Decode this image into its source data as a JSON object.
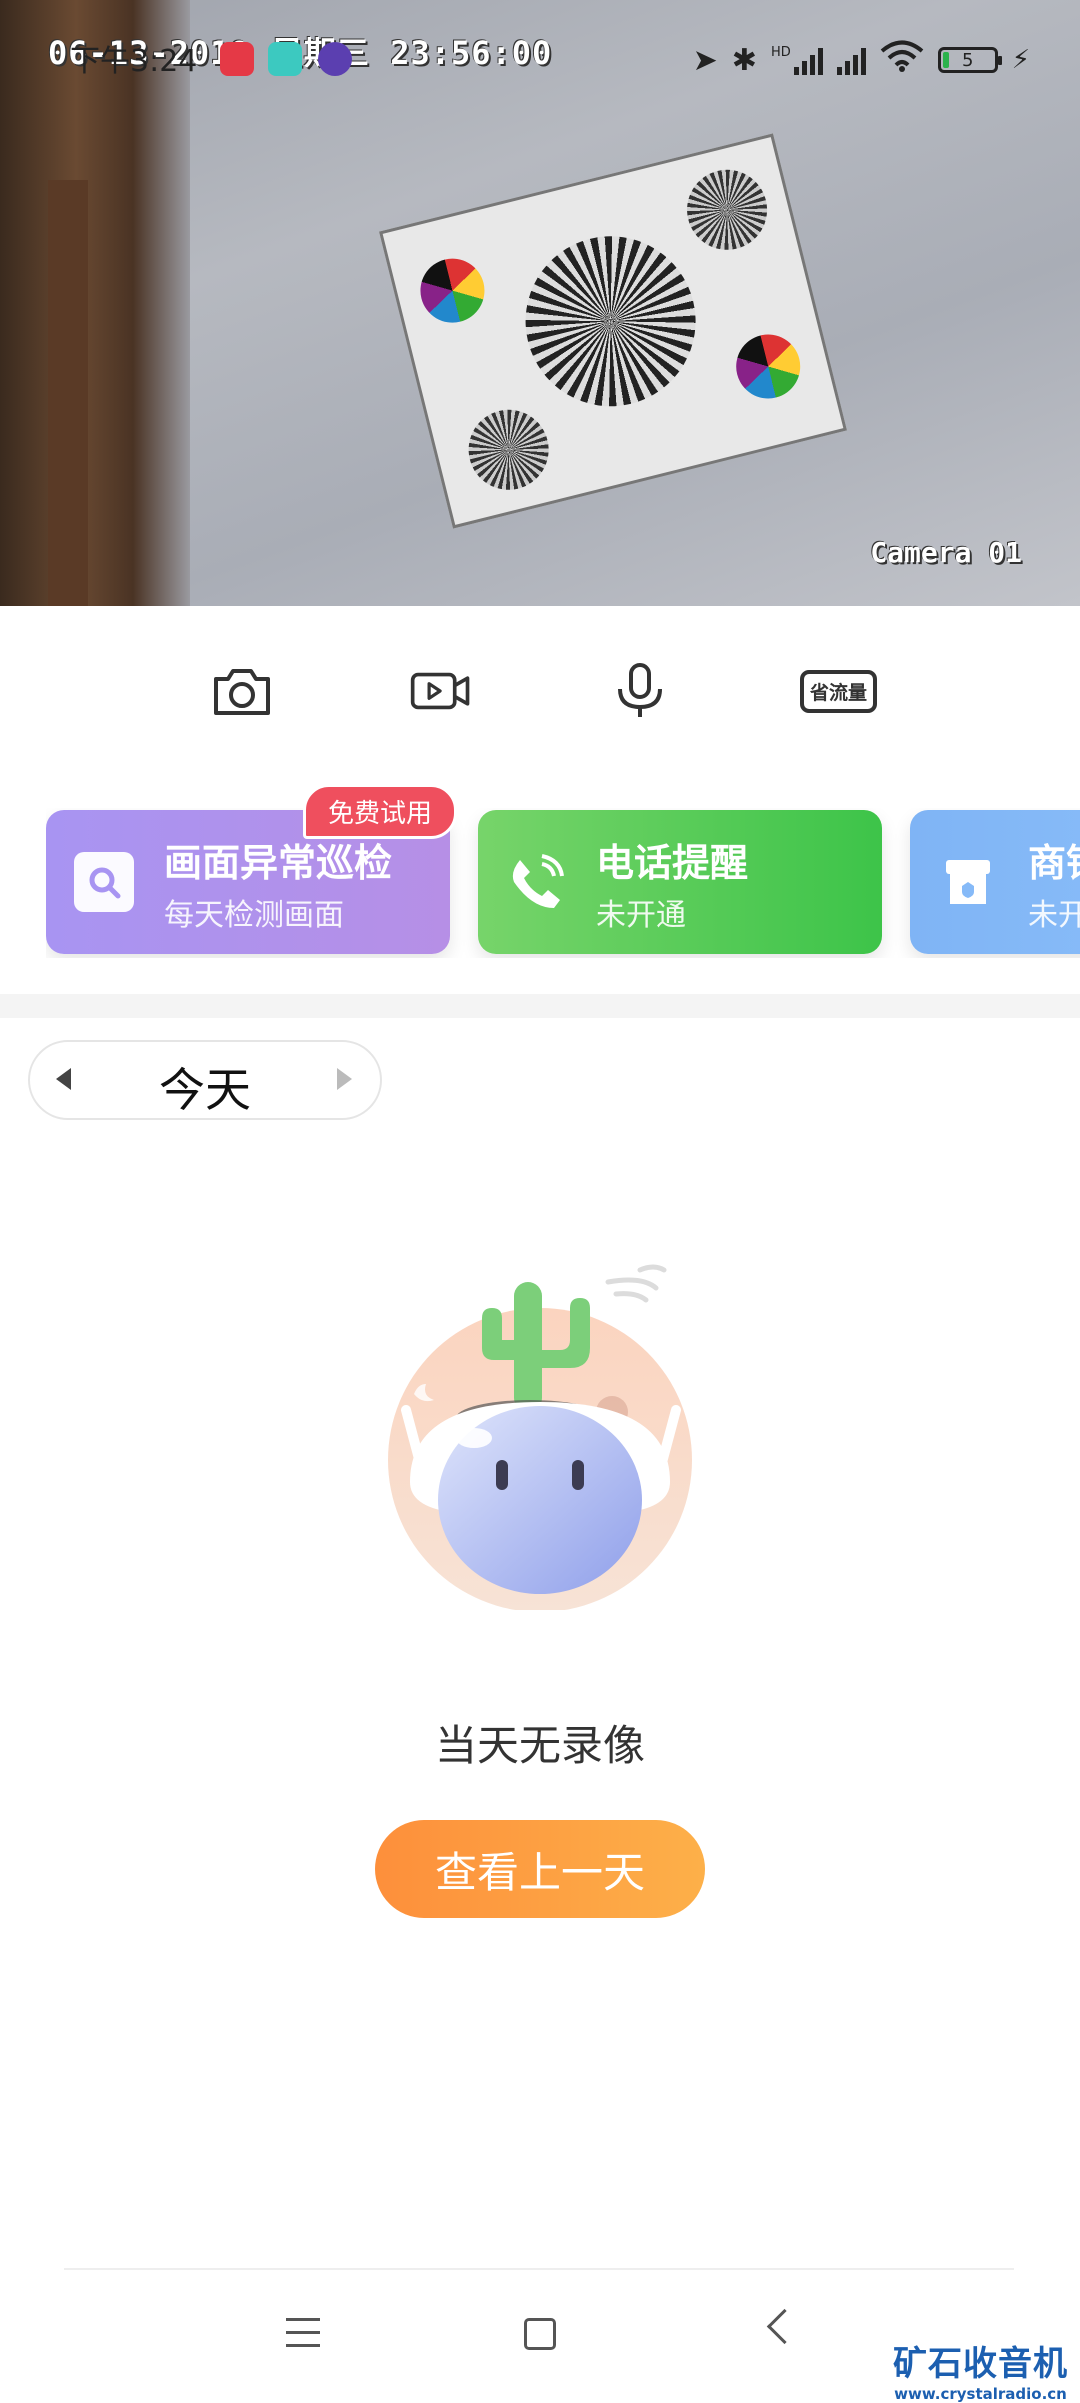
{
  "video": {
    "overlay_timestamp": "06-13-2019 星期三 23:56:00",
    "camera_label": "Camera 01"
  },
  "status_bar": {
    "time": "下午3:24",
    "network_badge": "HD",
    "battery_level": "5"
  },
  "controls": {
    "save_data_label": "省流量"
  },
  "service_cards": [
    {
      "title": "画面异常巡检",
      "subtitle": "每天检测画面",
      "badge": "免费试用",
      "color": "#b08ff0"
    },
    {
      "title": "电话提醒",
      "subtitle": "未开通",
      "color": "#4ec652"
    },
    {
      "title": "商铺",
      "subtitle": "未开通",
      "color": "#86baf8"
    }
  ],
  "date_picker": {
    "label": "今天"
  },
  "empty_state": {
    "message": "当天无录像",
    "button_label": "查看上一天"
  },
  "watermark": {
    "main": "矿石收音机",
    "url": "www.crystalradio.cn"
  }
}
